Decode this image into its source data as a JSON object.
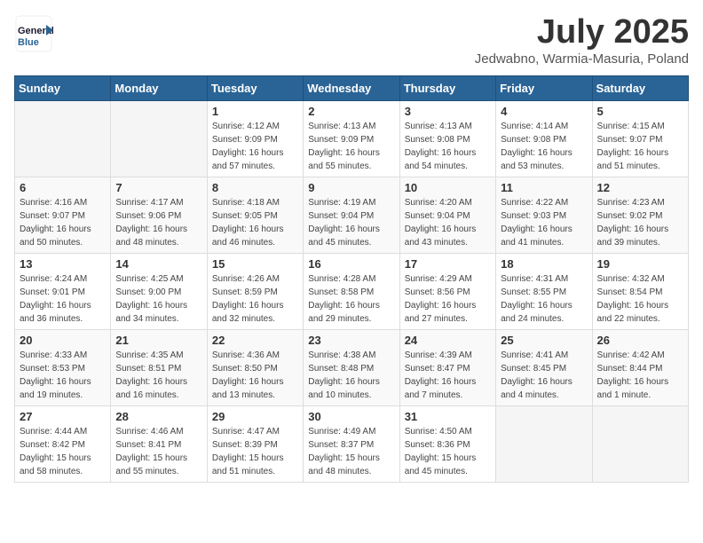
{
  "header": {
    "logo_general": "General",
    "logo_blue": "Blue",
    "month_title": "July 2025",
    "location": "Jedwabno, Warmia-Masuria, Poland"
  },
  "weekdays": [
    "Sunday",
    "Monday",
    "Tuesday",
    "Wednesday",
    "Thursday",
    "Friday",
    "Saturday"
  ],
  "weeks": [
    [
      {
        "day": "",
        "info": ""
      },
      {
        "day": "",
        "info": ""
      },
      {
        "day": "1",
        "info": "Sunrise: 4:12 AM\nSunset: 9:09 PM\nDaylight: 16 hours and 57 minutes."
      },
      {
        "day": "2",
        "info": "Sunrise: 4:13 AM\nSunset: 9:09 PM\nDaylight: 16 hours and 55 minutes."
      },
      {
        "day": "3",
        "info": "Sunrise: 4:13 AM\nSunset: 9:08 PM\nDaylight: 16 hours and 54 minutes."
      },
      {
        "day": "4",
        "info": "Sunrise: 4:14 AM\nSunset: 9:08 PM\nDaylight: 16 hours and 53 minutes."
      },
      {
        "day": "5",
        "info": "Sunrise: 4:15 AM\nSunset: 9:07 PM\nDaylight: 16 hours and 51 minutes."
      }
    ],
    [
      {
        "day": "6",
        "info": "Sunrise: 4:16 AM\nSunset: 9:07 PM\nDaylight: 16 hours and 50 minutes."
      },
      {
        "day": "7",
        "info": "Sunrise: 4:17 AM\nSunset: 9:06 PM\nDaylight: 16 hours and 48 minutes."
      },
      {
        "day": "8",
        "info": "Sunrise: 4:18 AM\nSunset: 9:05 PM\nDaylight: 16 hours and 46 minutes."
      },
      {
        "day": "9",
        "info": "Sunrise: 4:19 AM\nSunset: 9:04 PM\nDaylight: 16 hours and 45 minutes."
      },
      {
        "day": "10",
        "info": "Sunrise: 4:20 AM\nSunset: 9:04 PM\nDaylight: 16 hours and 43 minutes."
      },
      {
        "day": "11",
        "info": "Sunrise: 4:22 AM\nSunset: 9:03 PM\nDaylight: 16 hours and 41 minutes."
      },
      {
        "day": "12",
        "info": "Sunrise: 4:23 AM\nSunset: 9:02 PM\nDaylight: 16 hours and 39 minutes."
      }
    ],
    [
      {
        "day": "13",
        "info": "Sunrise: 4:24 AM\nSunset: 9:01 PM\nDaylight: 16 hours and 36 minutes."
      },
      {
        "day": "14",
        "info": "Sunrise: 4:25 AM\nSunset: 9:00 PM\nDaylight: 16 hours and 34 minutes."
      },
      {
        "day": "15",
        "info": "Sunrise: 4:26 AM\nSunset: 8:59 PM\nDaylight: 16 hours and 32 minutes."
      },
      {
        "day": "16",
        "info": "Sunrise: 4:28 AM\nSunset: 8:58 PM\nDaylight: 16 hours and 29 minutes."
      },
      {
        "day": "17",
        "info": "Sunrise: 4:29 AM\nSunset: 8:56 PM\nDaylight: 16 hours and 27 minutes."
      },
      {
        "day": "18",
        "info": "Sunrise: 4:31 AM\nSunset: 8:55 PM\nDaylight: 16 hours and 24 minutes."
      },
      {
        "day": "19",
        "info": "Sunrise: 4:32 AM\nSunset: 8:54 PM\nDaylight: 16 hours and 22 minutes."
      }
    ],
    [
      {
        "day": "20",
        "info": "Sunrise: 4:33 AM\nSunset: 8:53 PM\nDaylight: 16 hours and 19 minutes."
      },
      {
        "day": "21",
        "info": "Sunrise: 4:35 AM\nSunset: 8:51 PM\nDaylight: 16 hours and 16 minutes."
      },
      {
        "day": "22",
        "info": "Sunrise: 4:36 AM\nSunset: 8:50 PM\nDaylight: 16 hours and 13 minutes."
      },
      {
        "day": "23",
        "info": "Sunrise: 4:38 AM\nSunset: 8:48 PM\nDaylight: 16 hours and 10 minutes."
      },
      {
        "day": "24",
        "info": "Sunrise: 4:39 AM\nSunset: 8:47 PM\nDaylight: 16 hours and 7 minutes."
      },
      {
        "day": "25",
        "info": "Sunrise: 4:41 AM\nSunset: 8:45 PM\nDaylight: 16 hours and 4 minutes."
      },
      {
        "day": "26",
        "info": "Sunrise: 4:42 AM\nSunset: 8:44 PM\nDaylight: 16 hours and 1 minute."
      }
    ],
    [
      {
        "day": "27",
        "info": "Sunrise: 4:44 AM\nSunset: 8:42 PM\nDaylight: 15 hours and 58 minutes."
      },
      {
        "day": "28",
        "info": "Sunrise: 4:46 AM\nSunset: 8:41 PM\nDaylight: 15 hours and 55 minutes."
      },
      {
        "day": "29",
        "info": "Sunrise: 4:47 AM\nSunset: 8:39 PM\nDaylight: 15 hours and 51 minutes."
      },
      {
        "day": "30",
        "info": "Sunrise: 4:49 AM\nSunset: 8:37 PM\nDaylight: 15 hours and 48 minutes."
      },
      {
        "day": "31",
        "info": "Sunrise: 4:50 AM\nSunset: 8:36 PM\nDaylight: 15 hours and 45 minutes."
      },
      {
        "day": "",
        "info": ""
      },
      {
        "day": "",
        "info": ""
      }
    ]
  ]
}
